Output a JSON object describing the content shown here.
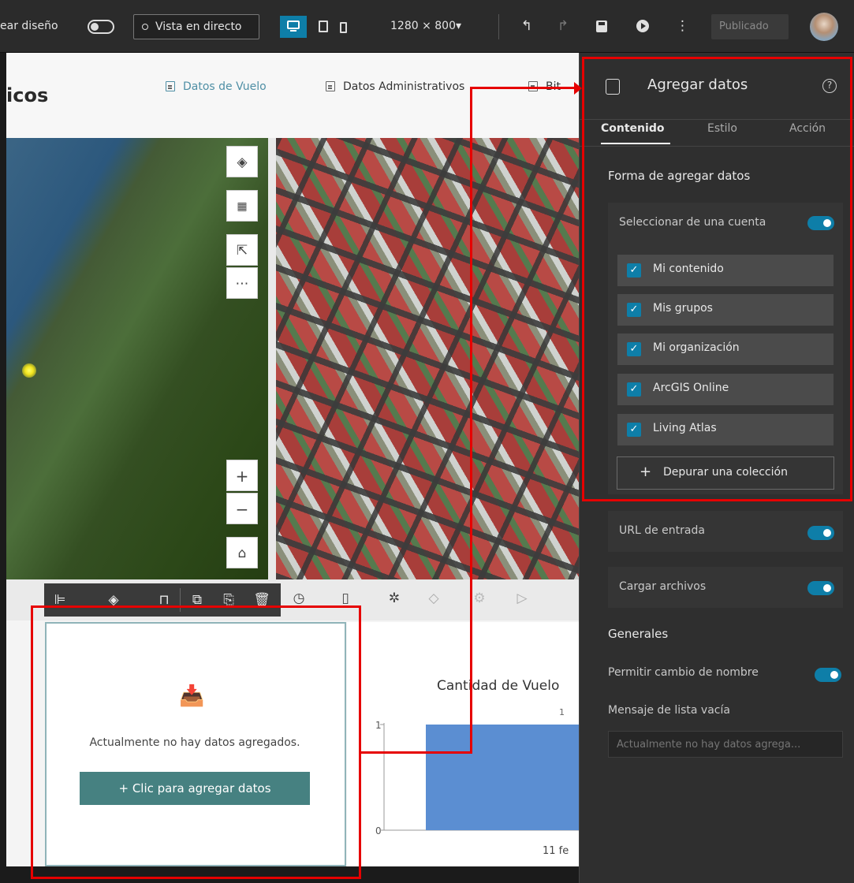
{
  "topbar": {
    "lock_layout_label": "ear diseño",
    "live_view_label": "Vista en directo",
    "resolution": "1280 × 800▾",
    "published_label": "Publicado"
  },
  "app": {
    "title_fragment": "icos",
    "nav": [
      "Datos de Vuelo",
      "Datos Administrativos",
      "Bit"
    ]
  },
  "widget": {
    "empty_message": "Actualmente no hay datos agregados.",
    "add_button": "Clic para agregar datos"
  },
  "chart_data": {
    "type": "bar",
    "title": "Cantidad de Vuelo",
    "categories": [
      "11 fe"
    ],
    "values": [
      1
    ],
    "ylim": [
      0,
      1
    ],
    "yticks": [
      "1",
      "0"
    ],
    "data_labels": [
      "1"
    ],
    "colors": [
      "#5b8ed2"
    ]
  },
  "panel": {
    "title": "Agregar datos",
    "tabs": [
      "Contenido",
      "Estilo",
      "Acción"
    ],
    "section_title": "Forma de agregar datos",
    "select_account_label": "Seleccionar de una cuenta",
    "sources": [
      "Mi contenido",
      "Mis grupos",
      "Mi organización",
      "ArcGIS Online",
      "Living Atlas"
    ],
    "refine_button": "Depurar una colección",
    "url_label": "URL de entrada",
    "upload_label": "Cargar archivos",
    "general_title": "Generales",
    "rename_label": "Permitir cambio de nombre",
    "empty_msg_label": "Mensaje de lista vacía",
    "empty_msg_placeholder": "Actualmente no hay datos agrega..."
  },
  "colors": {
    "accent": "#0e7ea8",
    "button_teal": "#468181",
    "annotation_red": "#e60000"
  }
}
